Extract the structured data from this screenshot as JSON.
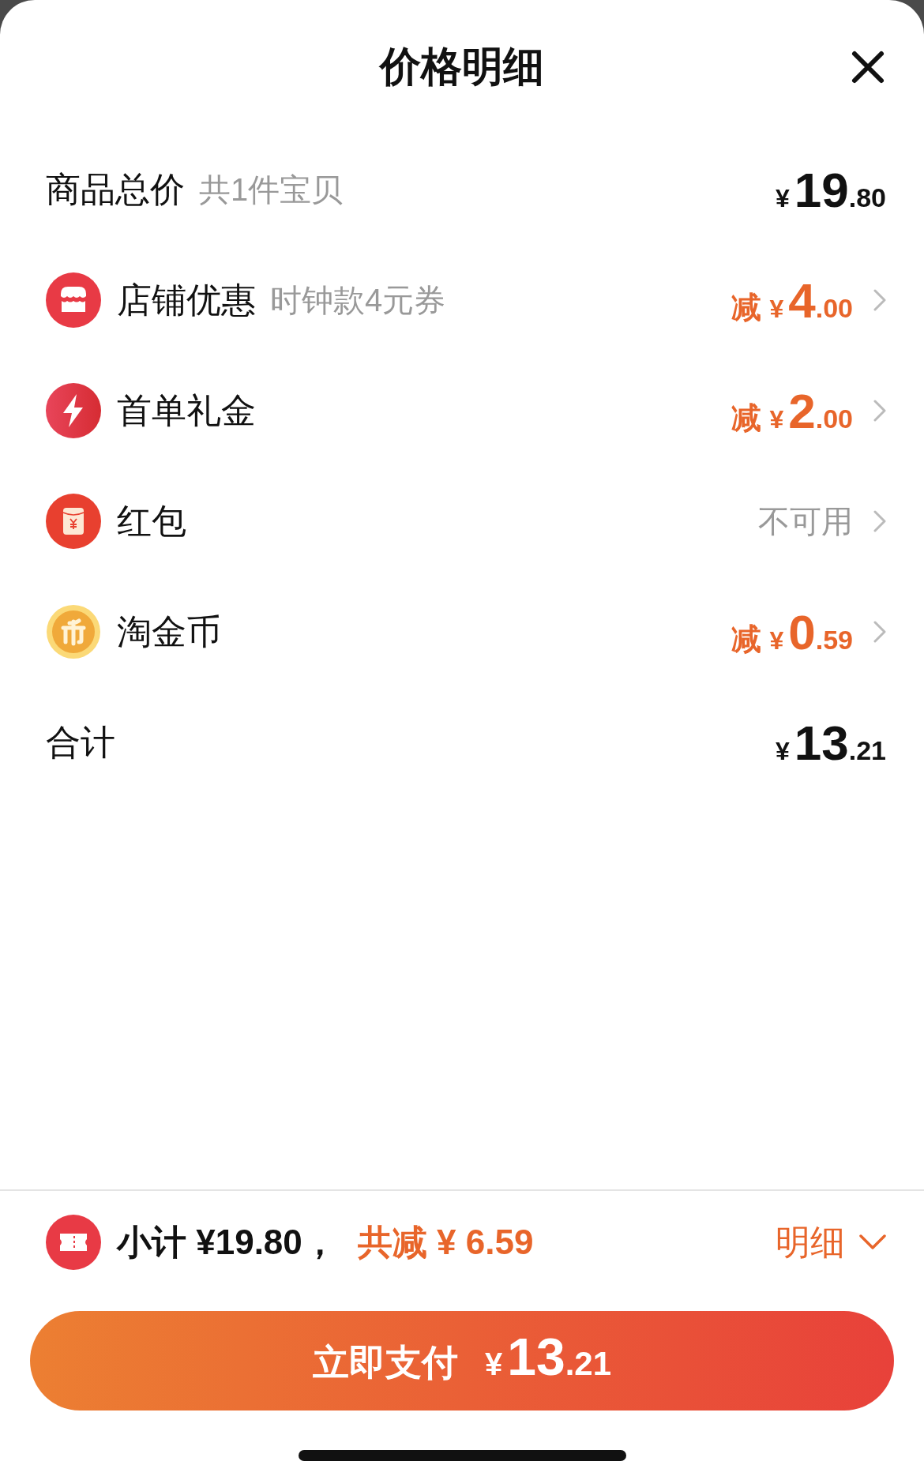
{
  "sheet": {
    "title": "价格明细"
  },
  "rows": [
    {
      "kind": "plain",
      "label": "商品总价",
      "note": "共1件宝贝",
      "price": {
        "yen": "¥",
        "integer": "19",
        "decimal": ".80"
      }
    },
    {
      "kind": "discount",
      "label": "店铺优惠",
      "note": "时钟款4元券",
      "prefix": "减",
      "price": {
        "yen": "¥",
        "integer": "4",
        "decimal": ".00"
      }
    },
    {
      "kind": "discount",
      "label": "首单礼金",
      "prefix": "减",
      "price": {
        "yen": "¥",
        "integer": "2",
        "decimal": ".00"
      }
    },
    {
      "kind": "unavailable",
      "label": "红包",
      "status": "不可用"
    },
    {
      "kind": "discount",
      "label": "淘金币",
      "prefix": "减",
      "price": {
        "yen": "¥",
        "integer": "0",
        "decimal": ".59"
      }
    },
    {
      "kind": "plain",
      "label": "合计",
      "price": {
        "yen": "¥",
        "integer": "13",
        "decimal": ".21"
      }
    }
  ],
  "summary": {
    "subtotal": "小计 ¥19.80，",
    "saving": "共减 ¥ 6.59",
    "detail": "明细"
  },
  "pay_button": {
    "label": "立即支付",
    "yen": "¥",
    "integer": "13",
    "decimal": ".21"
  }
}
